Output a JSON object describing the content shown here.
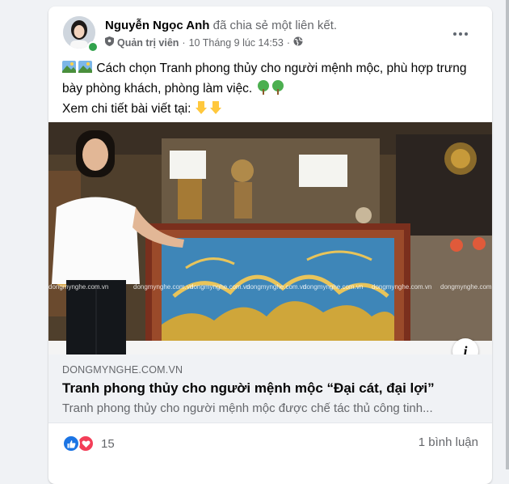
{
  "post": {
    "author": "Nguyễn Ngọc Anh",
    "action": "đã chia sẻ một liên kết.",
    "role": "Quản trị viên",
    "timestamp": "10 Tháng 9 lúc 14:53",
    "separator": "·",
    "text_line1": "Cách chọn Tranh phong thủy cho người mệnh mộc, phù hợp trưng bày phòng khách, phòng làm việc.",
    "text_line2": "Xem chi tiết bài viết tại:"
  },
  "photo": {
    "watermark": "dongmynghe.com.vn"
  },
  "link": {
    "domain": "DONGMYNGHE.COM.VN",
    "title": "Tranh phong thủy cho người mệnh mộc “Đại cát, đại lợi”",
    "description": "Tranh phong thủy cho người mệnh mộc được chế tác thủ công tinh..."
  },
  "footer": {
    "reaction_count": "15",
    "comment_count": "1 bình luận"
  },
  "icons": {
    "more": "more-icon",
    "shield": "shield-icon",
    "globe": "globe-icon",
    "info": "info-icon",
    "like": "like-icon",
    "love": "love-icon"
  },
  "colors": {
    "like_blue": "#1b74e4",
    "love_red": "#f33e58",
    "online_green": "#31a24c",
    "muted_text": "#65676b"
  }
}
